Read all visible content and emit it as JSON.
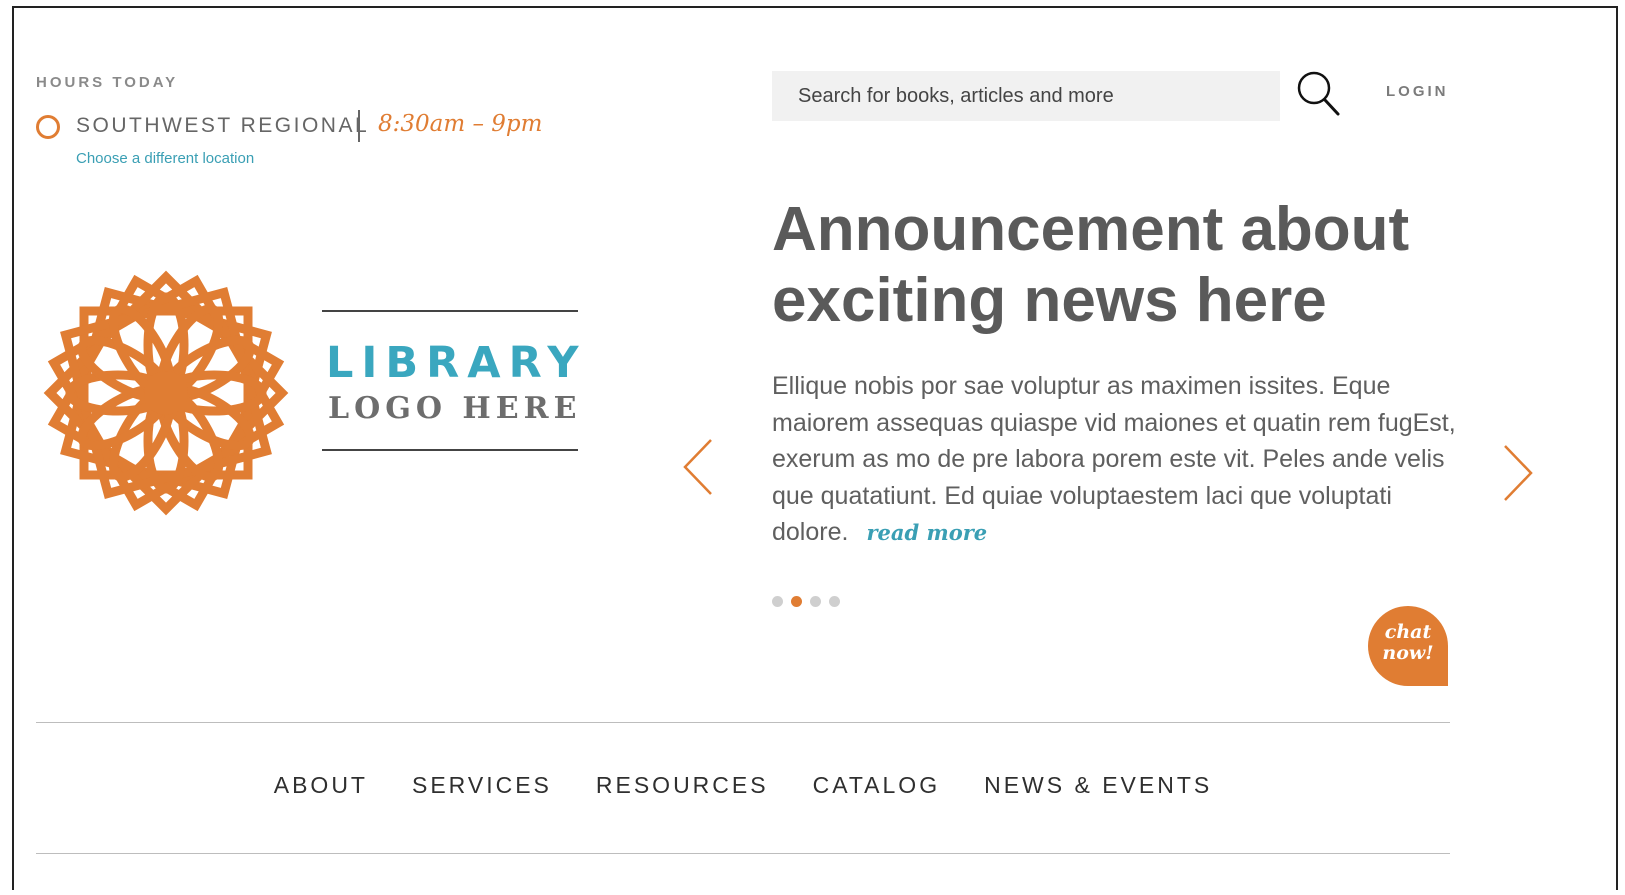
{
  "hours": {
    "label": "HOURS TODAY",
    "location": "SOUTHWEST REGIONAL",
    "time": "8:30am – 9pm",
    "change_link": "Choose a different location"
  },
  "logo": {
    "line1": "LIBRARY",
    "line2": "LOGO HERE"
  },
  "search": {
    "placeholder": "Search for books, articles and more"
  },
  "header": {
    "login": "LOGIN"
  },
  "announcement": {
    "title": "Announcement about exciting news here",
    "body": "Ellique nobis por sae voluptur as maximen issites. Eque maiorem assequas quiaspe vid maiones et quatin rem fugEst, exerum as mo de pre labora porem este vit. Peles ande velis que quatatiunt. Ed quiae voluptaestem laci que voluptati dolore.",
    "read_more": "read more",
    "slide_count": 4,
    "active_slide": 2
  },
  "chat": {
    "line1": "chat",
    "line2": "now!"
  },
  "nav": {
    "items": [
      {
        "label": "ABOUT"
      },
      {
        "label": "SERVICES"
      },
      {
        "label": "RESOURCES"
      },
      {
        "label": "CATALOG"
      },
      {
        "label": "NEWS & EVENTS"
      }
    ]
  },
  "colors": {
    "accent_orange": "#e07d33",
    "accent_teal": "#3aa7bf",
    "text_gray": "#5a5a5a"
  }
}
